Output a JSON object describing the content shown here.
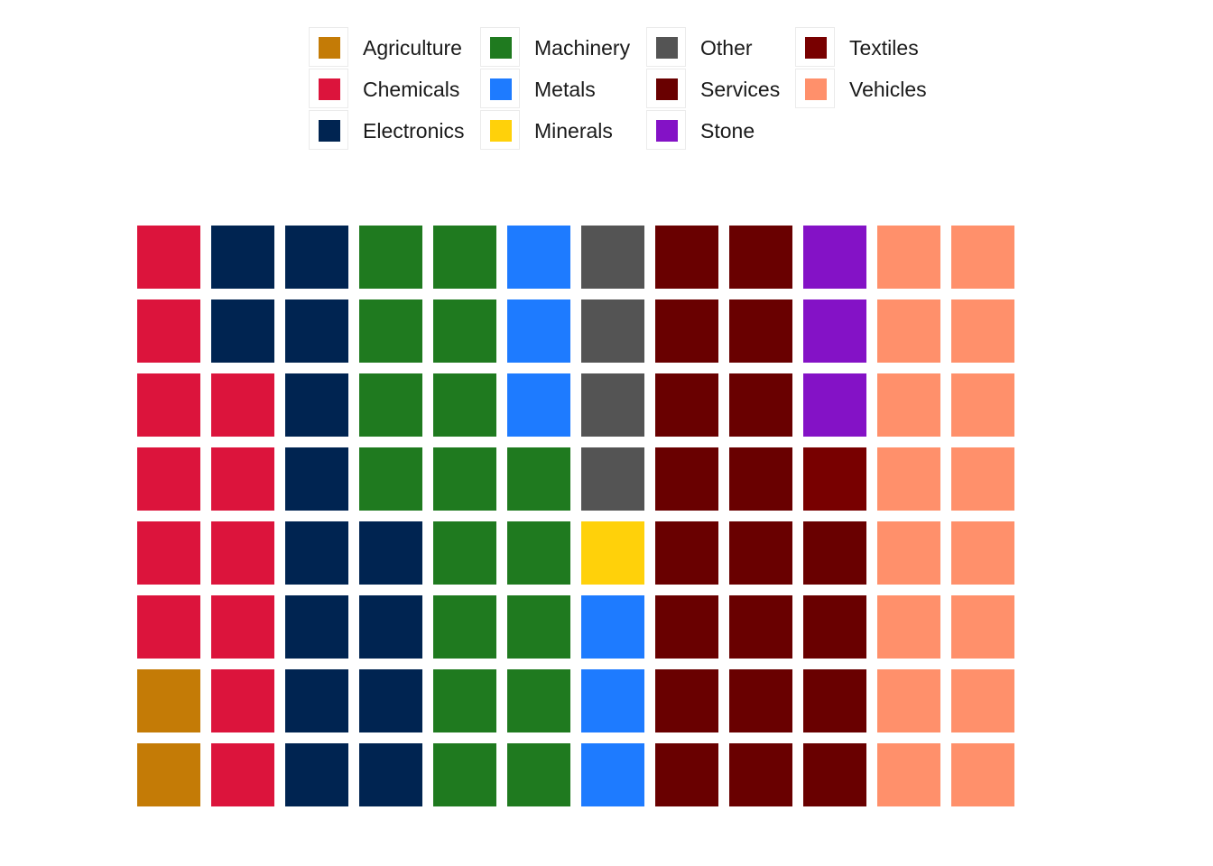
{
  "chart_data": {
    "type": "waffle",
    "title": "",
    "legend_position": "top",
    "n_rows": 8,
    "n_cols": 13,
    "fill_order": "column-wise, bottom-to-top",
    "categories": [
      {
        "name": "Agriculture",
        "value": 2,
        "color": "#C47B06"
      },
      {
        "name": "Chemicals",
        "value": 12,
        "color": "#DC143C"
      },
      {
        "name": "Electronics",
        "value": 14,
        "color": "#002451"
      },
      {
        "name": "Machinery",
        "value": 17,
        "color": "#1F7A1F"
      },
      {
        "name": "Metals",
        "value": 6,
        "color": "#1E7BFF"
      },
      {
        "name": "Minerals",
        "value": 1,
        "color": "#FFD10A"
      },
      {
        "name": "Other",
        "value": 4,
        "color": "#545454"
      },
      {
        "name": "Services",
        "value": 20,
        "color": "#690000"
      },
      {
        "name": "Textiles",
        "value": 1,
        "color": "#780000"
      },
      {
        "name": "Stone",
        "value": 3,
        "color": "#8412C6"
      },
      {
        "name": "Vehicles",
        "value": 16,
        "color": "#FF906B"
      }
    ],
    "legend_order": [
      "Agriculture",
      "Chemicals",
      "Electronics",
      "Machinery",
      "Metals",
      "Minerals",
      "Other",
      "Services",
      "Stone",
      "Textiles",
      "Vehicles"
    ]
  }
}
